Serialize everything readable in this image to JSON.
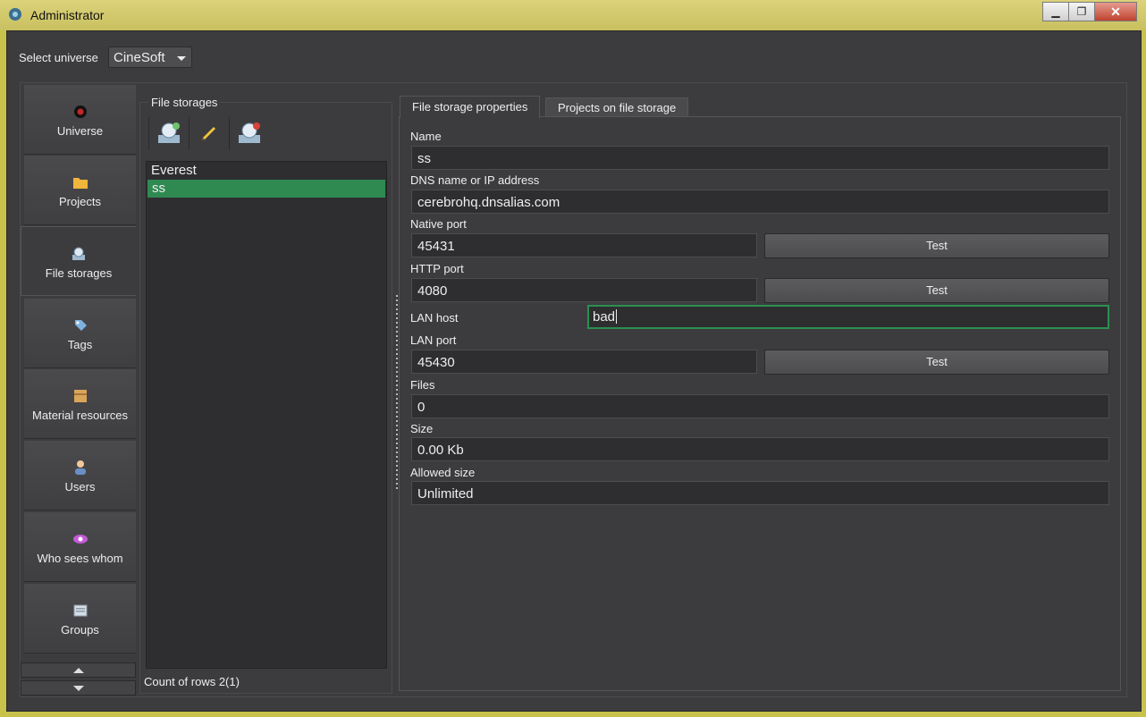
{
  "window": {
    "title": "Administrator",
    "minimize": "▁",
    "maximize": "❐",
    "close": "✕"
  },
  "universe": {
    "label": "Select universe",
    "selected": "CineSoft"
  },
  "sidebar": {
    "items": [
      {
        "label": "Universe",
        "icon": "universe-icon"
      },
      {
        "label": "Projects",
        "icon": "folder-icon"
      },
      {
        "label": "File storages",
        "icon": "storage-icon"
      },
      {
        "label": "Tags",
        "icon": "tag-icon"
      },
      {
        "label": "Material resources",
        "icon": "box-icon"
      },
      {
        "label": "Users",
        "icon": "user-icon"
      },
      {
        "label": "Who sees whom",
        "icon": "eye-icon"
      },
      {
        "label": "Groups",
        "icon": "group-icon"
      }
    ],
    "active": "File storages"
  },
  "file_storages": {
    "title": "File storages",
    "rows": [
      "Everest",
      "ss"
    ],
    "selected": "ss",
    "row_count": "Count of rows 2(1)"
  },
  "tabs": [
    "File storage properties",
    "Projects on file storage"
  ],
  "properties": {
    "name_label": "Name",
    "name_value": "ss",
    "dns_label": "DNS name or IP address",
    "dns_value": "cerebrohq.dnsalias.com",
    "native_port_label": "Native port",
    "native_port_value": "45431",
    "http_port_label": "HTTP port",
    "http_port_value": "4080",
    "lan_host_label": "LAN host",
    "lan_host_value": "bad",
    "lan_port_label": "LAN port",
    "lan_port_value": "45430",
    "files_label": "Files",
    "files_value": "0",
    "size_label": "Size",
    "size_value": "0.00 Kb",
    "allowed_size_label": "Allowed size",
    "allowed_size_value": "Unlimited",
    "test_label": "Test"
  },
  "colors": {
    "background": "#3c3c3f",
    "selection": "#2f8a52",
    "focus_border": "#2c8f50"
  }
}
